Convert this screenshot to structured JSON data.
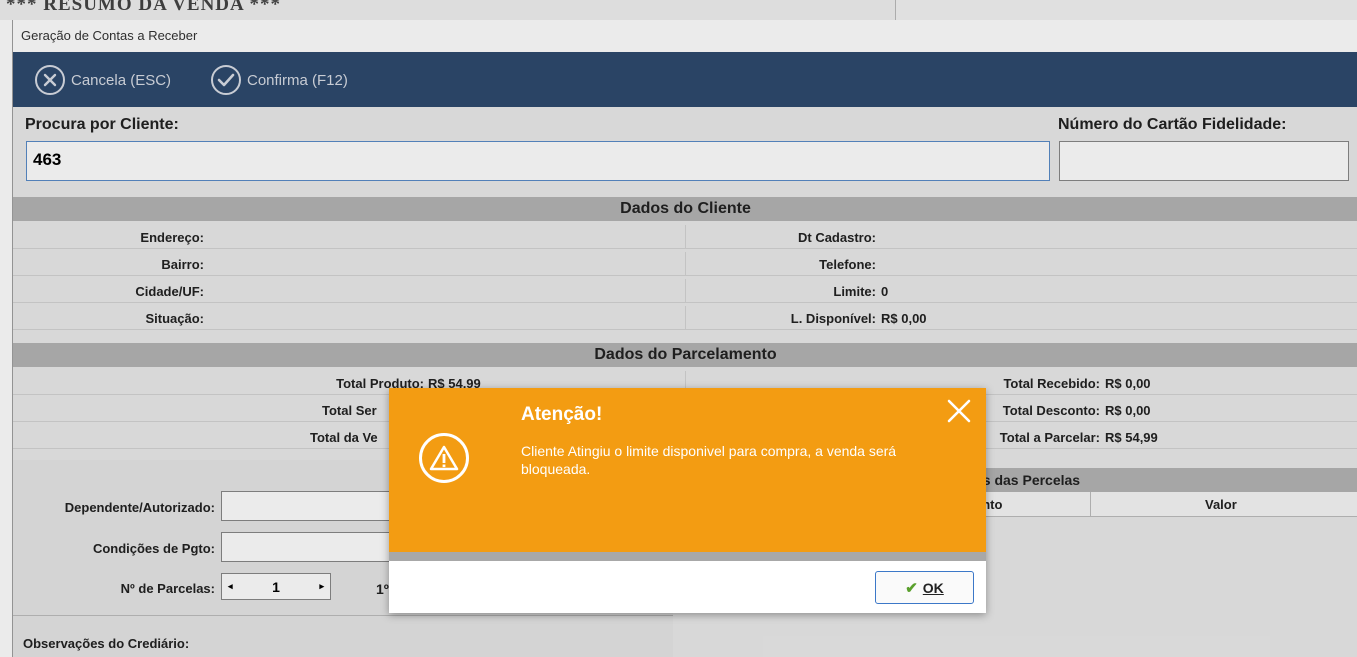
{
  "background_window": {
    "title_fragment": "*** RESUMO DA VENDA ***"
  },
  "window": {
    "title": "Geração de Contas a Receber"
  },
  "toolbar": {
    "cancel_label": "Cancela (ESC)",
    "confirm_label": "Confirma (F12)"
  },
  "search": {
    "client_label": "Procura por Cliente:",
    "client_value": "463",
    "loyalty_label": "Número do Cartão Fidelidade:",
    "loyalty_value": ""
  },
  "client_data": {
    "title": "Dados do Cliente",
    "left": [
      {
        "label": "Endereço:",
        "value": ""
      },
      {
        "label": "Bairro:",
        "value": ""
      },
      {
        "label": "Cidade/UF:",
        "value": ""
      },
      {
        "label": "Situação:",
        "value": ""
      }
    ],
    "right": [
      {
        "label": "Dt Cadastro:",
        "value": ""
      },
      {
        "label": "Telefone:",
        "value": ""
      },
      {
        "label": "Limite:",
        "value": "0"
      },
      {
        "label": "L. Disponível:",
        "value": "R$ 0,00"
      }
    ]
  },
  "installment_data": {
    "title": "Dados do Parcelamento",
    "left": [
      {
        "label": "Total Produto:",
        "value": "R$ 54,99"
      },
      {
        "label": "Total Ser",
        "value": ""
      },
      {
        "label": "Total da Ve",
        "value": ""
      }
    ],
    "right": [
      {
        "label": "Total Recebido:",
        "value": "R$ 0,00"
      },
      {
        "label": "Total Desconto:",
        "value": "R$ 0,00"
      },
      {
        "label": "Total a Parcelar:",
        "value": "R$ 54,99"
      }
    ]
  },
  "form": {
    "dependent_label": "Dependente/Autorizado:",
    "conditions_label": "Condições de Pgto:",
    "installments_label": "Nº de Parcelas:",
    "installments_value": "1",
    "first_due_fragment": "1º",
    "notes_label": "Observações do Crediário:"
  },
  "parcel_values": {
    "title_fragment": "es das Percelas",
    "col_due_fragment": "ento",
    "col_value": "Valor"
  },
  "dialog": {
    "title": "Atenção!",
    "message": "Cliente Atingiu o limite disponivel para compra, a venda será bloqueada.",
    "ok_label": "OK",
    "close_glyph": "✕",
    "warning_glyph": "!",
    "ok_check_glyph": "✔"
  },
  "colors": {
    "toolbar": "#2e4a6e",
    "dialog_header": "#f39c12",
    "ok_border": "#3c78c8",
    "check": "#5aa02c"
  }
}
